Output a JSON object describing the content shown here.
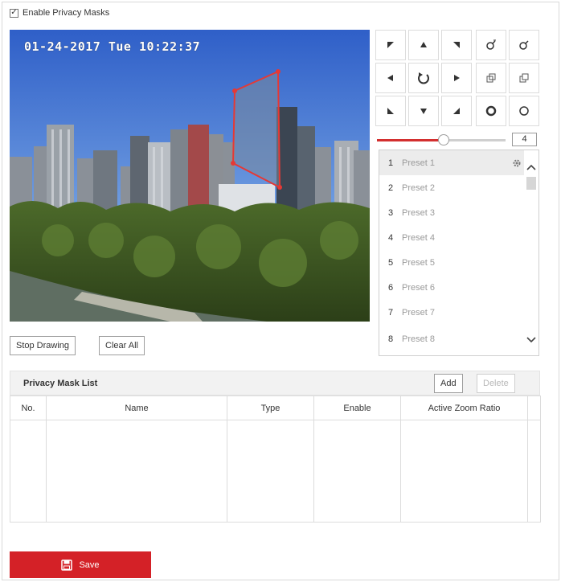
{
  "privacy": {
    "enable_label": "Enable Privacy Masks",
    "enabled": true
  },
  "video": {
    "osd_text": "01-24-2017 Tue 10:22:37"
  },
  "ptz": {
    "speed_value": "4",
    "speed_fraction": 0.52,
    "pad_icons": [
      "arrow-up-left-icon",
      "arrow-up-icon",
      "arrow-up-right-icon",
      "arrow-left-icon",
      "auto-rotate-icon",
      "arrow-right-icon",
      "arrow-down-left-icon",
      "arrow-down-icon",
      "arrow-down-right-icon"
    ],
    "lens_icons": [
      "zoom-in-icon",
      "zoom-out-icon",
      "focus-near-icon",
      "focus-far-icon",
      "iris-open-icon",
      "iris-close-icon"
    ]
  },
  "presets": [
    {
      "no": "1",
      "name": "Preset 1"
    },
    {
      "no": "2",
      "name": "Preset 2"
    },
    {
      "no": "3",
      "name": "Preset 3"
    },
    {
      "no": "4",
      "name": "Preset 4"
    },
    {
      "no": "5",
      "name": "Preset 5"
    },
    {
      "no": "6",
      "name": "Preset 6"
    },
    {
      "no": "7",
      "name": "Preset 7"
    },
    {
      "no": "8",
      "name": "Preset 8"
    }
  ],
  "actions": {
    "stop_drawing": "Stop Drawing",
    "clear_all": "Clear All"
  },
  "mask_list": {
    "title": "Privacy Mask List",
    "add": "Add",
    "delete": "Delete",
    "columns": [
      "No.",
      "Name",
      "Type",
      "Enable",
      "Active Zoom Ratio"
    ]
  },
  "save": {
    "label": "Save"
  },
  "colors": {
    "accent": "#d42127",
    "mask": "#e53935"
  }
}
